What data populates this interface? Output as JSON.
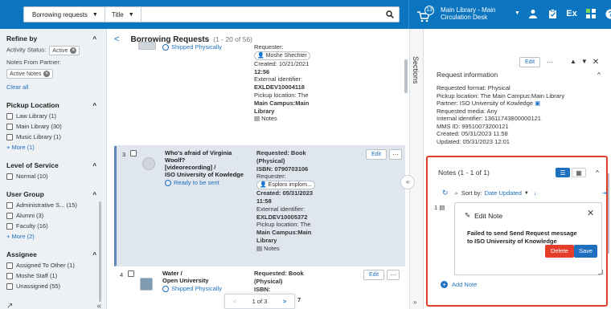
{
  "colors": {
    "topbar": "#0c75c0",
    "accent": "#1e6fbf",
    "danger": "#e43e2b",
    "highlight_border": "#e43e2b"
  },
  "topbar": {
    "scope_label": "Borrowing requests",
    "field_label": "Title",
    "search_value": "",
    "cart_count": "13",
    "location_line1": "Main Library - Main",
    "location_line2": "Circulation Desk",
    "icons": [
      "user-icon",
      "task-list-icon",
      "ex-libris-icon",
      "apps-grid-icon",
      "help-icon"
    ],
    "ex_label": "Ex"
  },
  "facets": {
    "refine_by": "Refine by",
    "activity_status_label": "Activity Status:",
    "activity_status_value": "Active",
    "notes_from_partner_label": "Notes From Partner:",
    "notes_chip": "Active Notes",
    "clear_all": "Clear all",
    "groups": [
      {
        "title": "Pickup Location",
        "items": [
          "Law Library (1)",
          "Main Library (30)",
          "Music Library (1)"
        ],
        "more": "More (1)"
      },
      {
        "title": "Level of Service",
        "items": [
          "Normal (10)"
        ]
      },
      {
        "title": "User Group",
        "items": [
          "Administrative S... (15)",
          "Alumni (3)",
          "Faculty (16)"
        ],
        "more": "More (2)"
      },
      {
        "title": "Assignee",
        "items": [
          "Assigned To Other (1)",
          "Moshe Staff (1)",
          "Unassigned (55)"
        ]
      }
    ]
  },
  "list": {
    "back": "<",
    "title": "Borrowing Requests",
    "count": "(1 - 20 of 56)",
    "edit_label": "Edit",
    "more_label": "···",
    "records": [
      {
        "num": "",
        "title": "",
        "status": "Shipped Physically",
        "details": {
          "requester_label": "Requester:",
          "requester": "Moshe Shechter",
          "created": "Created: 10/21/2021",
          "created_time": "12:56",
          "ext_id_label": "External identifier:",
          "ext_id": "EXLDEV10004118",
          "pickup": "Pickup location: The",
          "pickup2": "Main Campus:Main",
          "pickup3": "Library",
          "notes": "Notes"
        }
      },
      {
        "num": "3",
        "title": "Who's afraid of Virginia Woolf?",
        "title2": "[videorecording] /",
        "publisher": "ISO University of Kowledge",
        "status": "Ready to be sent",
        "details": {
          "requested_label": "Requested: Book",
          "requested2": "(Physical)",
          "isbn": "ISBN: 0790703106",
          "requester_label": "Requester:",
          "requester": "Esploro implom...",
          "created": "Created: 05/31/2023",
          "created_time": "11:58",
          "ext_id_label": "External identifier:",
          "ext_id": "EXLDEV10005372",
          "pickup": "Pickup location: The",
          "pickup2": "Main Campus:Main",
          "pickup3": "Library",
          "notes": "Notes"
        }
      },
      {
        "num": "4",
        "title": "Water /",
        "publisher": "Open University",
        "status": "Shipped Physically",
        "details": {
          "requested_label": "Requested: Book",
          "requested2": "(Physical)",
          "isbn": "ISBN:",
          "isbn_tail": "7"
        }
      }
    ],
    "pager": {
      "current": "1 of 3",
      "prev": "<",
      "next": ">"
    }
  },
  "sections_label": "Sections",
  "details": {
    "edit_label": "Edit",
    "section_title": "Request information",
    "lines": [
      "Requested format: Physical",
      "Pickup location: The Main Campus:Main Library",
      "Partner: ISO University of Kowledge",
      "Requested media: Any",
      "Internal identifier: 13611743800000121",
      "MMS ID: 99510073200121",
      "Created: 05/31/2023 11:58",
      "Updated: 05/31/2023 12:01"
    ],
    "notes": {
      "title": "Notes (1 - 1 of 1)",
      "sort_label": "Sort by:",
      "sort_value": "Date Updated",
      "note_num": "1",
      "edit_note_title": "Edit Note",
      "note_text": "Failed to send Send Request message to ISO University of Knowledge",
      "delete_label": "Delete",
      "save_label": "Save",
      "add_note": "Add Note"
    }
  }
}
